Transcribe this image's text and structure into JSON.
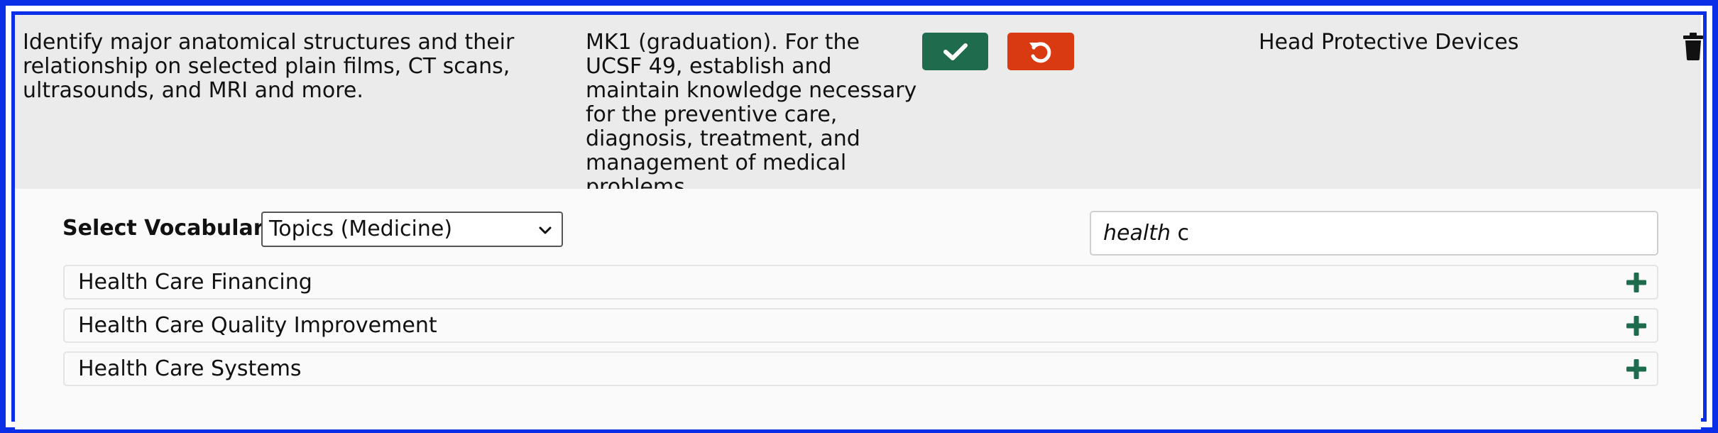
{
  "objective_row": {
    "objective_text": "Identify major anatomical structures and their relationship on selected plain films, CT scans, ultrasounds, and MRI and more.",
    "competency_text": "MK1 (graduation). For the UCSF 49, establish and maintain knowledge necessary for the preventive care, diagnosis, treatment, and management of medical problems.",
    "accept_icon": "check-icon",
    "undo_icon": "undo-icon",
    "mesh_term": "Head Protective Devices",
    "delete_icon": "trash-icon"
  },
  "vocabulary_panel": {
    "select_label": "Select Vocabulary:",
    "selected_vocabulary": "Topics (Medicine)",
    "search_value_typed": "health",
    "search_value_rest": " c",
    "results": [
      {
        "label": "Health Care Financing"
      },
      {
        "label": "Health Care Quality Improvement"
      },
      {
        "label": "Health Care Systems"
      }
    ],
    "add_icon": "plus-icon"
  },
  "colors": {
    "frame_blue": "#0a2fe6",
    "accept_green": "#1f6b4e",
    "undo_red": "#d93a12",
    "row_gray": "#ebebeb"
  }
}
